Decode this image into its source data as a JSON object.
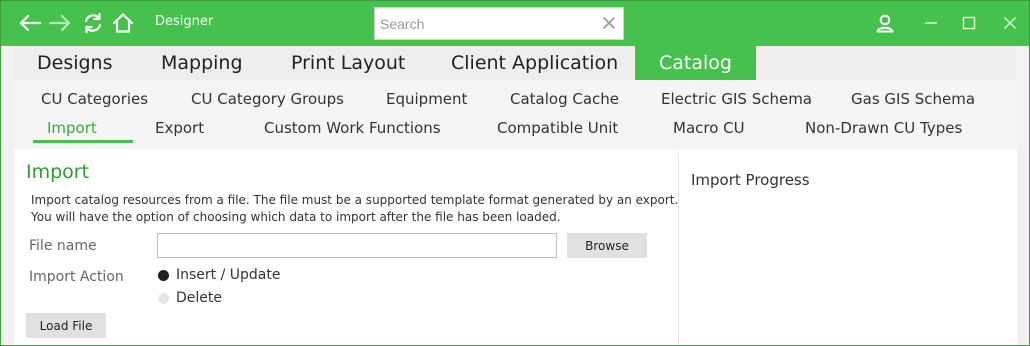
{
  "titlebar": {
    "app_title": "Designer",
    "search_placeholder": "Search",
    "icons": [
      "back-arrow-icon",
      "forward-arrow-icon",
      "refresh-icon",
      "home-icon",
      "user-icon",
      "minimize-icon",
      "maximize-icon",
      "close-icon"
    ],
    "accent_color": "#46c14e"
  },
  "main_tabs": [
    {
      "label": "Designs"
    },
    {
      "label": "Mapping"
    },
    {
      "label": "Print Layout"
    },
    {
      "label": "Client Application"
    },
    {
      "label": "Catalog",
      "active": true
    }
  ],
  "sub_tabs_row1": [
    {
      "label": "CU Categories"
    },
    {
      "label": "CU Category Groups"
    },
    {
      "label": "Equipment"
    },
    {
      "label": "Catalog Cache"
    },
    {
      "label": "Electric GIS Schema"
    },
    {
      "label": "Gas GIS Schema"
    }
  ],
  "sub_tabs_row2": [
    {
      "label": "Import",
      "active": true
    },
    {
      "label": "Export"
    },
    {
      "label": "Custom Work Functions"
    },
    {
      "label": "Compatible Unit"
    },
    {
      "label": "Macro CU"
    },
    {
      "label": "Non-Drawn CU Types"
    }
  ],
  "import_panel": {
    "title": "Import",
    "description": "Import catalog resources from a file. The file must be a supported template format generated by an export. You will have the option of choosing which data to import after the file has been loaded.",
    "file_name_label": "File name",
    "file_name_value": "",
    "browse_label": "Browse",
    "import_action_label": "Import Action",
    "options": [
      {
        "label": "Insert / Update",
        "selected": true
      },
      {
        "label": "Delete",
        "selected": false
      }
    ],
    "load_file_label": "Load File"
  },
  "progress_panel": {
    "title": "Import Progress"
  }
}
